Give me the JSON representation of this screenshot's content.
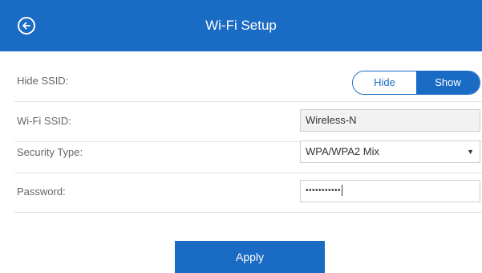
{
  "header": {
    "title": "Wi-Fi Setup",
    "back_icon": "back-circle-arrow-icon"
  },
  "rows": {
    "hide_ssid": {
      "label": "Hide SSID:",
      "options": [
        "Hide",
        "Show"
      ],
      "selected": "Show"
    },
    "ssid": {
      "label": "Wi-Fi SSID:",
      "value": "Wireless-N"
    },
    "security": {
      "label": "Security Type:",
      "value": "WPA/WPA2 Mix"
    },
    "password": {
      "label": "Password:",
      "masked_value": "•••••••••••"
    }
  },
  "actions": {
    "apply_label": "Apply"
  },
  "colors": {
    "accent": "#1a6bc4"
  }
}
